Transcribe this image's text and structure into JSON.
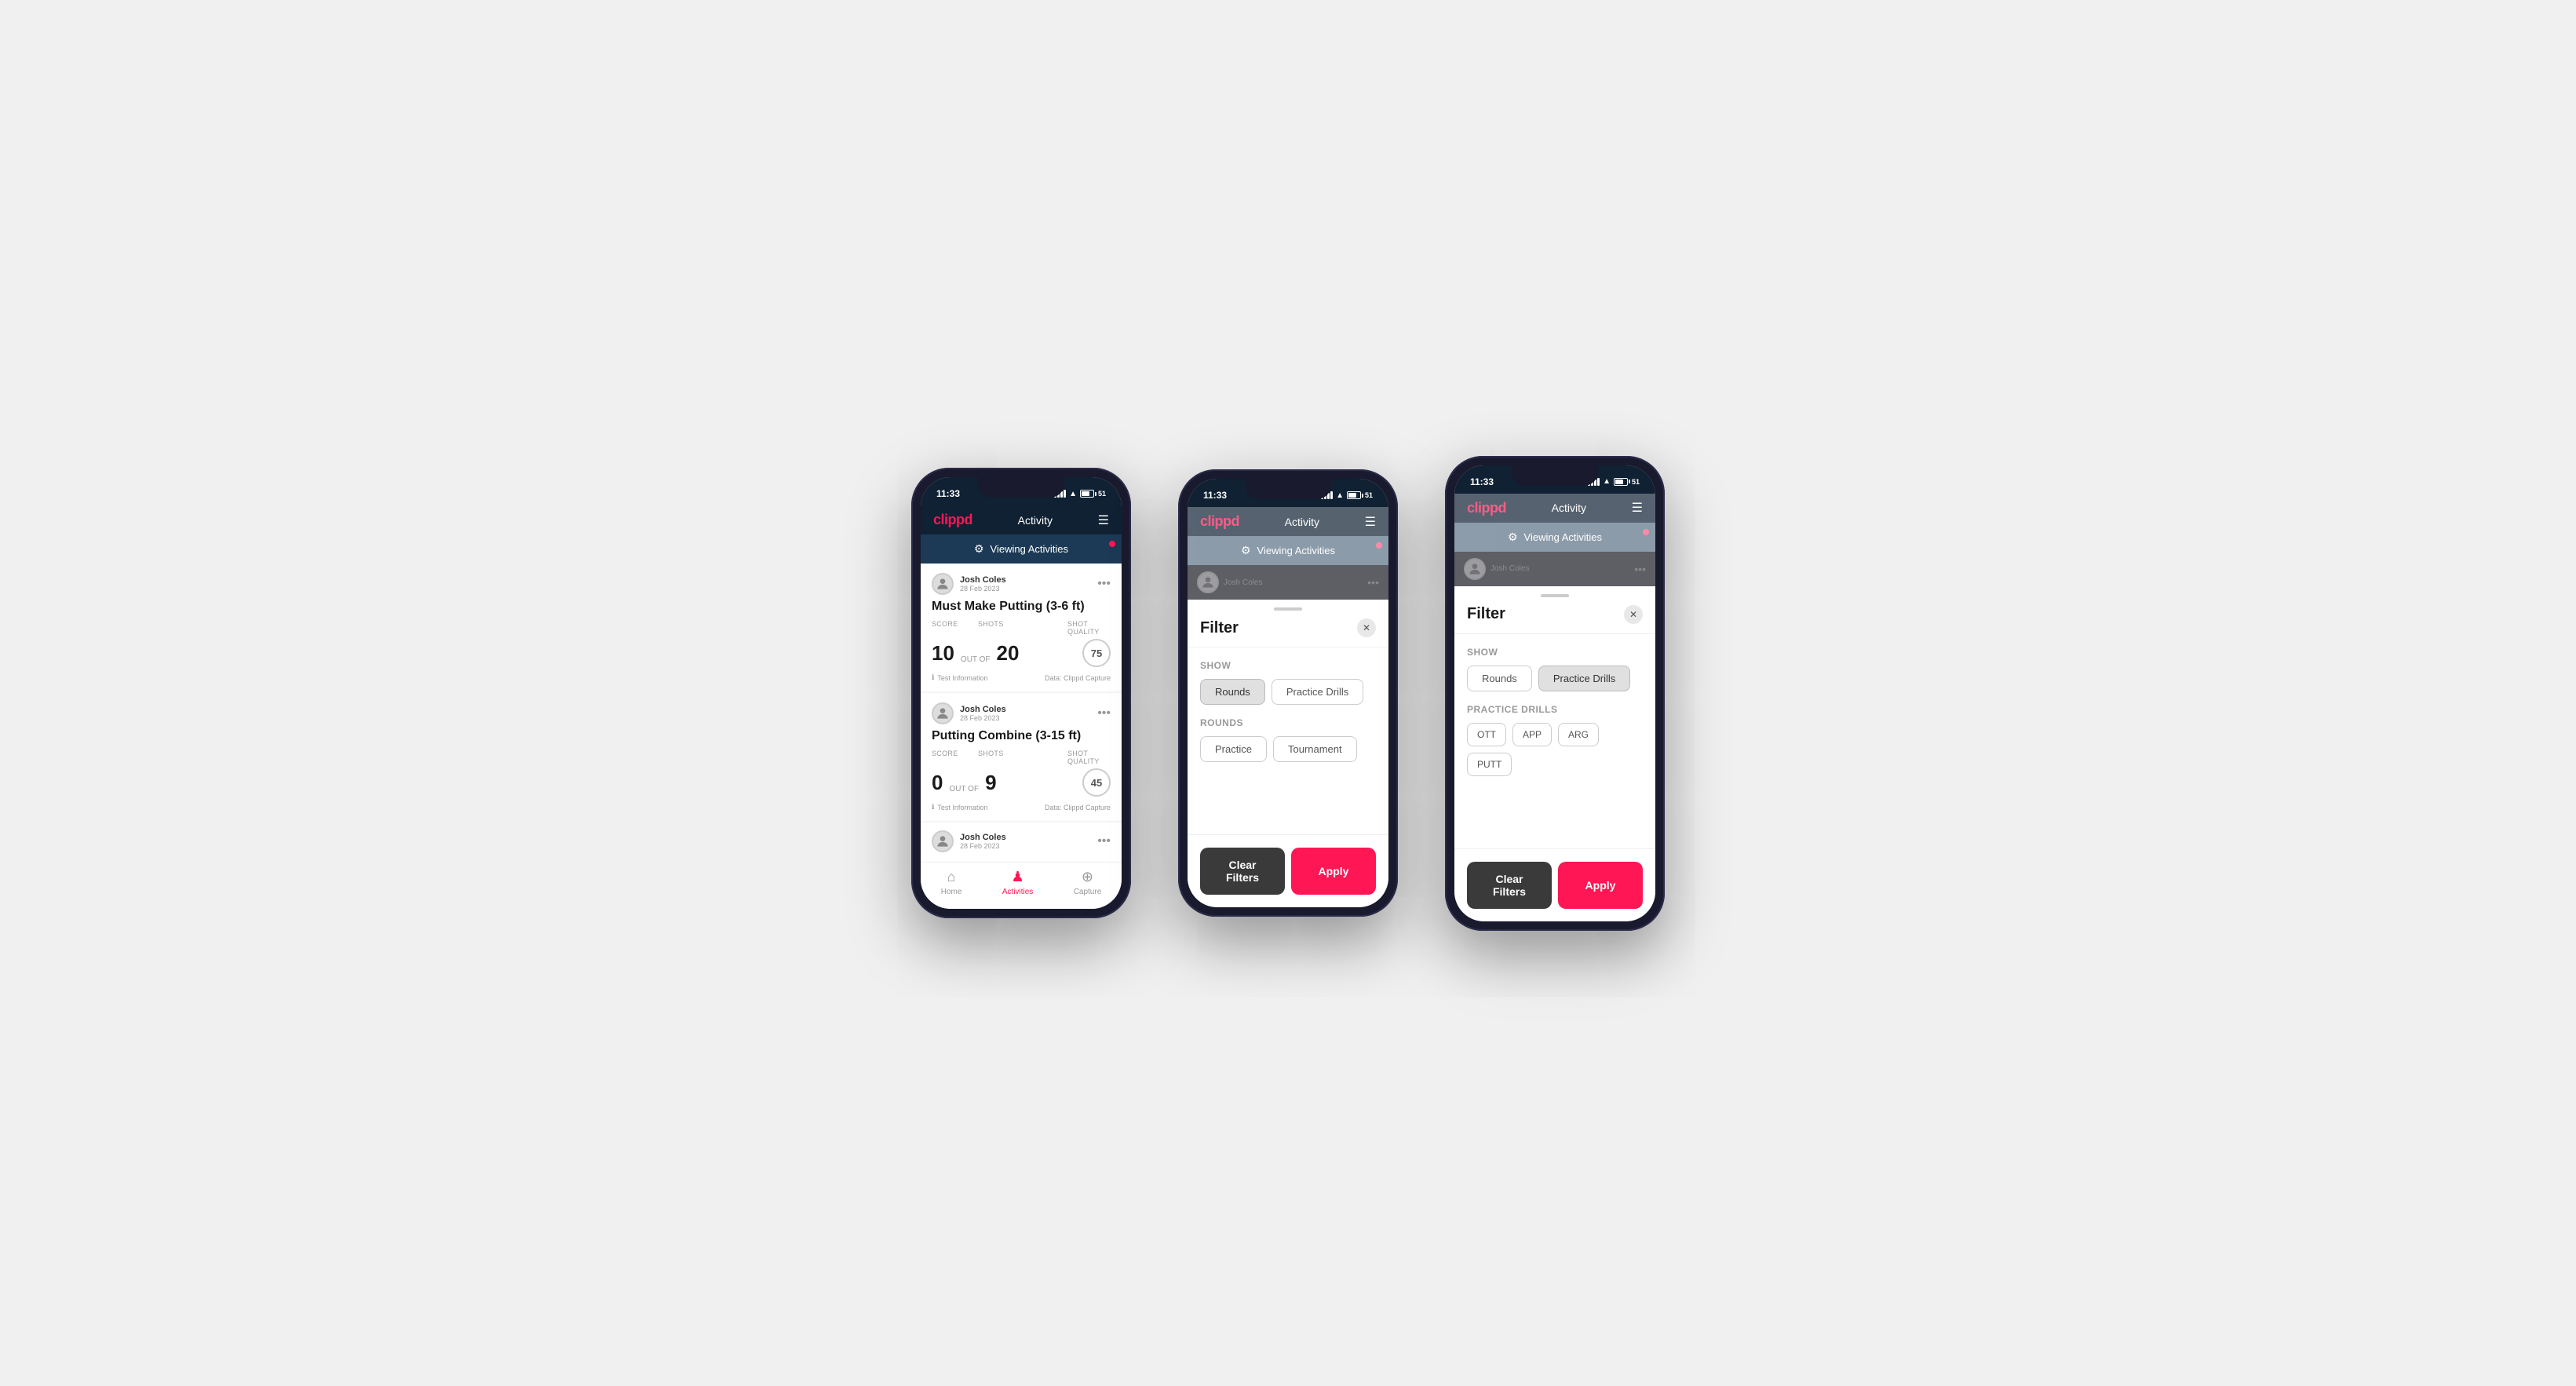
{
  "app": {
    "logo": "clippd",
    "title": "Activity",
    "time": "11:33",
    "battery": "51"
  },
  "viewing_bar": {
    "text": "Viewing Activities"
  },
  "phone1": {
    "cards": [
      {
        "user_name": "Josh Coles",
        "user_date": "28 Feb 2023",
        "title": "Must Make Putting (3-6 ft)",
        "score_label": "Score",
        "score_value": "10",
        "out_of": "OUT OF",
        "shots_label": "Shots",
        "shots_value": "20",
        "sq_label": "Shot Quality",
        "sq_value": "75",
        "footer_left": "Test Information",
        "footer_right": "Data: Clippd Capture"
      },
      {
        "user_name": "Josh Coles",
        "user_date": "28 Feb 2023",
        "title": "Putting Combine (3-15 ft)",
        "score_label": "Score",
        "score_value": "0",
        "out_of": "OUT OF",
        "shots_label": "Shots",
        "shots_value": "9",
        "sq_label": "Shot Quality",
        "sq_value": "45",
        "footer_left": "Test Information",
        "footer_right": "Data: Clippd Capture"
      }
    ],
    "nav": {
      "home": "Home",
      "activities": "Activities",
      "capture": "Capture"
    }
  },
  "filter_sheet": {
    "title": "Filter",
    "show_label": "Show",
    "show_pills": [
      "Rounds",
      "Practice Drills"
    ],
    "rounds_label": "Rounds",
    "rounds_pills": [
      "Practice",
      "Tournament"
    ],
    "practice_drills_label": "Practice Drills",
    "drill_pills": [
      "OTT",
      "APP",
      "ARG",
      "PUTT"
    ],
    "clear_label": "Clear Filters",
    "apply_label": "Apply"
  },
  "phone2": {
    "active_show": "Rounds",
    "active_round": "none"
  },
  "phone3": {
    "active_show": "Practice Drills",
    "active_drill": "none"
  }
}
